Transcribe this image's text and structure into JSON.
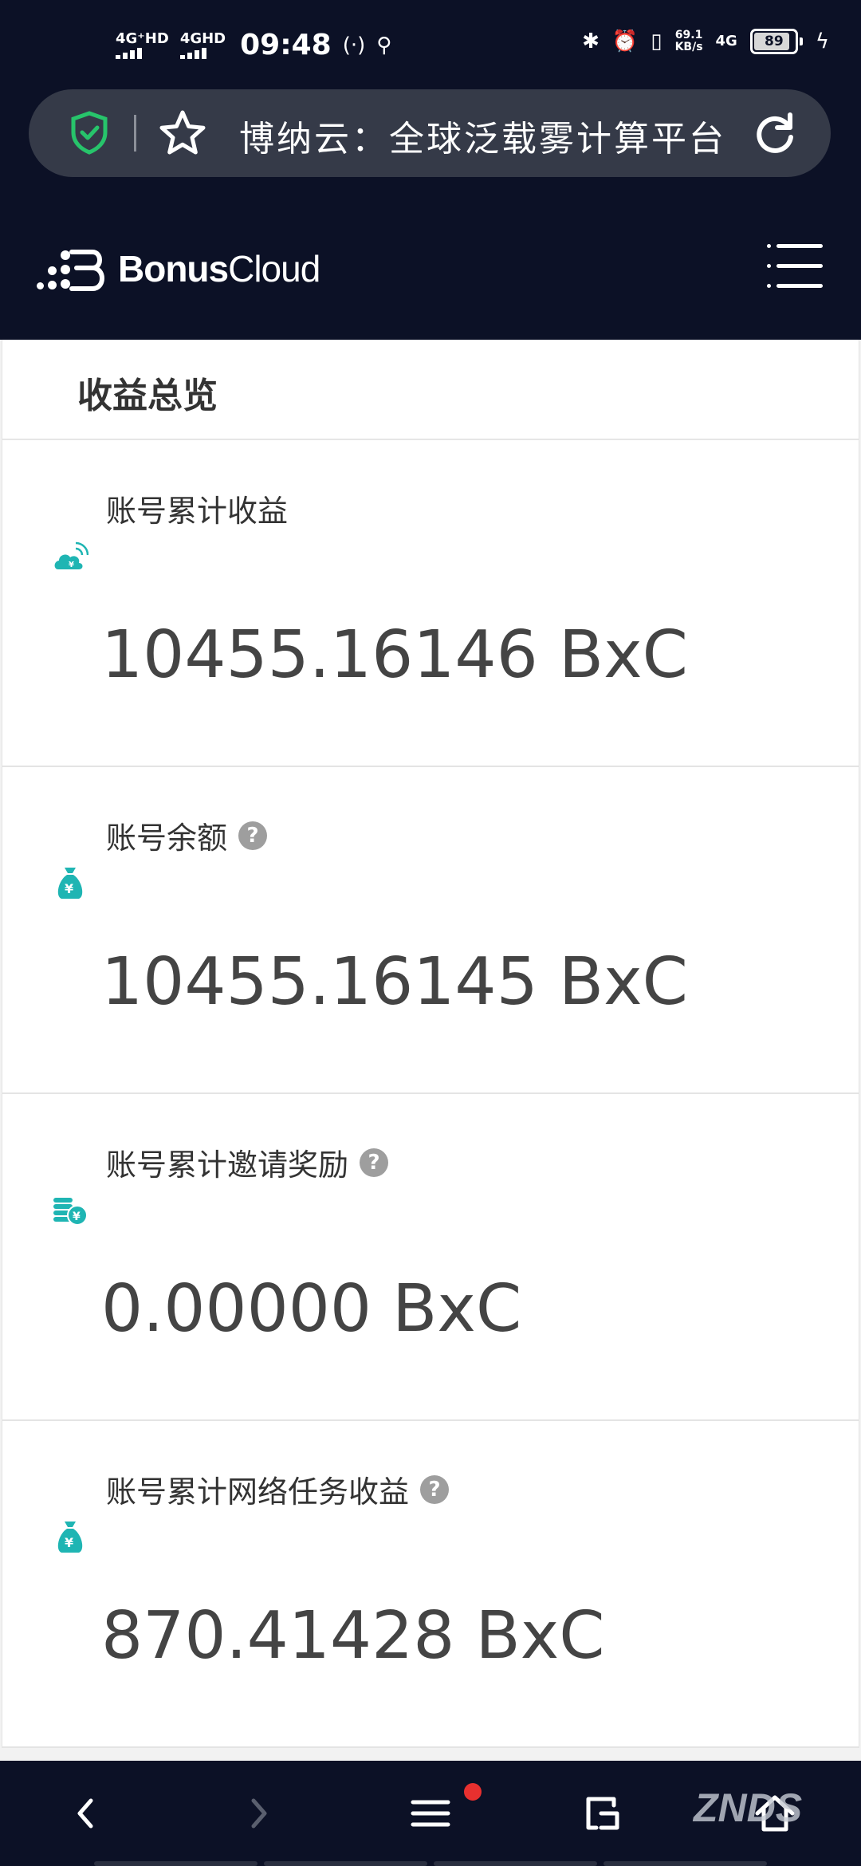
{
  "status_bar": {
    "signal1": "4G⁺HD",
    "signal2": "4GHD",
    "time": "09:48",
    "speed_value": "69.1",
    "speed_unit": "KB/s",
    "network": "4G",
    "battery": "89",
    "battery_level": 0.89
  },
  "browser": {
    "page_title": "博纳云：全球泛载雾计算平台",
    "accent_color": "#27c46b"
  },
  "site": {
    "logo_bold": "Bonus",
    "logo_light": "Cloud"
  },
  "overview": {
    "title": "收益总览"
  },
  "cards": [
    {
      "label": "账号累计收益",
      "value": "10455.16146 BxC",
      "icon": "cloud-coin-icon",
      "has_help": false
    },
    {
      "label": "账号余额",
      "value": "10455.16145 BxC",
      "icon": "money-bag-icon",
      "has_help": true
    },
    {
      "label": "账号累计邀请奖励",
      "value": "0.00000 BxC",
      "icon": "coin-stack-icon",
      "has_help": true
    },
    {
      "label": "账号累计网络任务收益",
      "value": "870.41428 BxC",
      "icon": "money-bag-icon",
      "has_help": true
    }
  ],
  "help_glyph": "?",
  "icon_color": "#1fb5b3",
  "bottom_nav": {
    "watermark": "ZNDS",
    "has_notification": true
  }
}
